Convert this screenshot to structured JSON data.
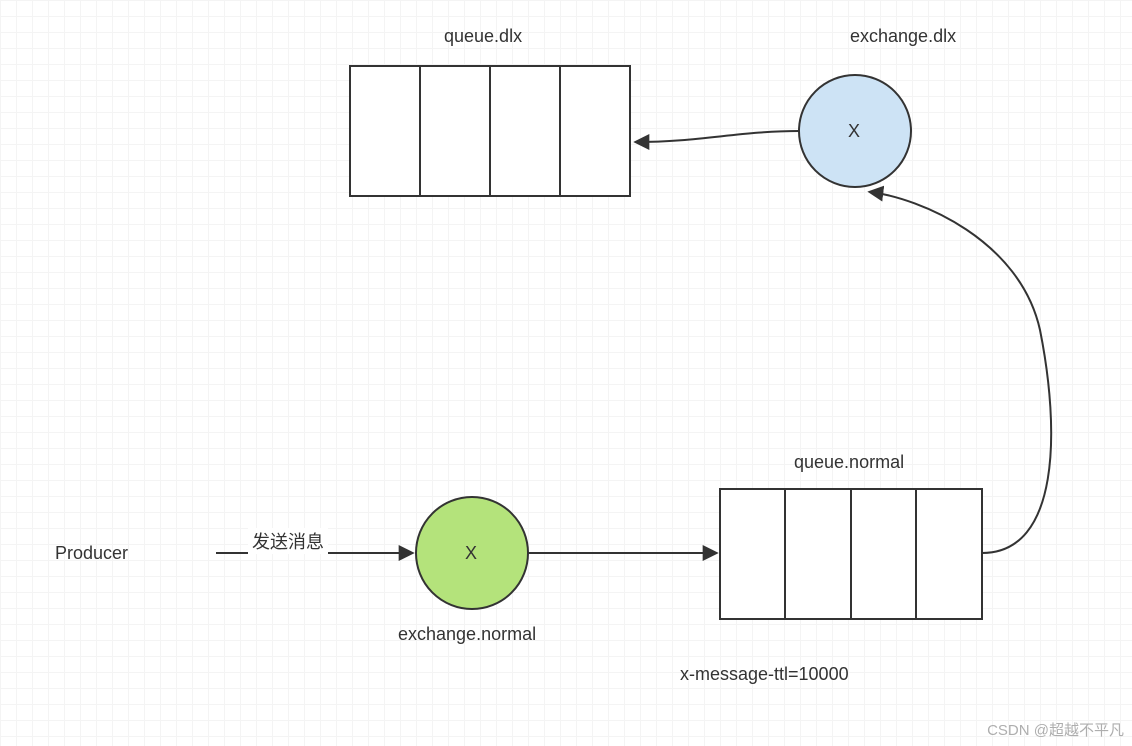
{
  "producer": "Producer",
  "send_msg": "发送消息",
  "exchange_normal": {
    "label": "exchange.normal",
    "symbol": "X"
  },
  "queue_normal": {
    "label": "queue.normal",
    "ttl": "x-message-ttl=10000"
  },
  "exchange_dlx": {
    "label": "exchange.dlx",
    "symbol": "X"
  },
  "queue_dlx": {
    "label": "queue.dlx"
  },
  "watermark": "CSDN @超越不平凡"
}
